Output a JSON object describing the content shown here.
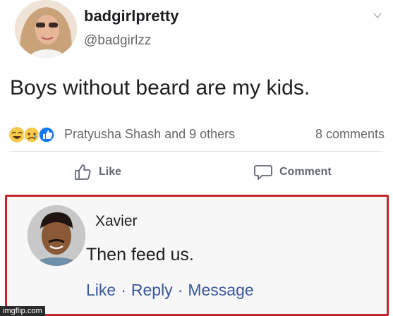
{
  "post": {
    "author_name": "badgirlpretty",
    "author_handle": "@badgirlzz",
    "text": "Boys without beard are my kids.",
    "reactors": "Pratyusha Shash and 9 others",
    "comments_count": "8 comments",
    "like_label": "Like",
    "comment_label": "Comment",
    "reaction_icons": [
      "haha-icon",
      "sad-icon",
      "like-reaction-icon"
    ]
  },
  "comment": {
    "author_name": "Xavier",
    "text": "Then feed us.",
    "actions": {
      "like": "Like",
      "reply": "Reply",
      "message": "Message",
      "separator": "·"
    }
  },
  "watermark": "imgflip.com",
  "colors": {
    "highlight_border": "#c0262d",
    "link_blue": "#385898",
    "muted_text": "#65676b"
  }
}
